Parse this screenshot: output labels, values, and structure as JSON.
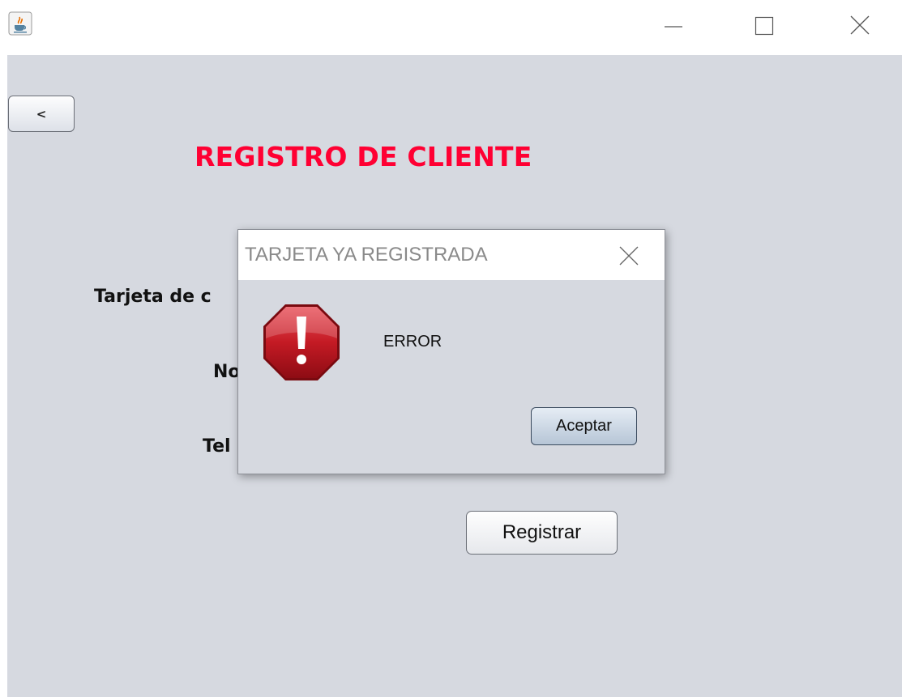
{
  "window": {
    "icon": "java-cup-icon",
    "controls": [
      "minimize-icon",
      "maximize-icon",
      "close-icon"
    ]
  },
  "form": {
    "back_label": "<",
    "title": "REGISTRO DE CLIENTE",
    "labels": {
      "tarjeta": "Tarjeta de c",
      "nombre": "No",
      "telefono": "Tel"
    },
    "register_label": "Registrar",
    "title_color": "#ff0033"
  },
  "dialog": {
    "title": "TARJETA YA REGISTRADA",
    "icon": "error-stop-icon",
    "message": "ERROR",
    "accept_label": "Aceptar"
  }
}
